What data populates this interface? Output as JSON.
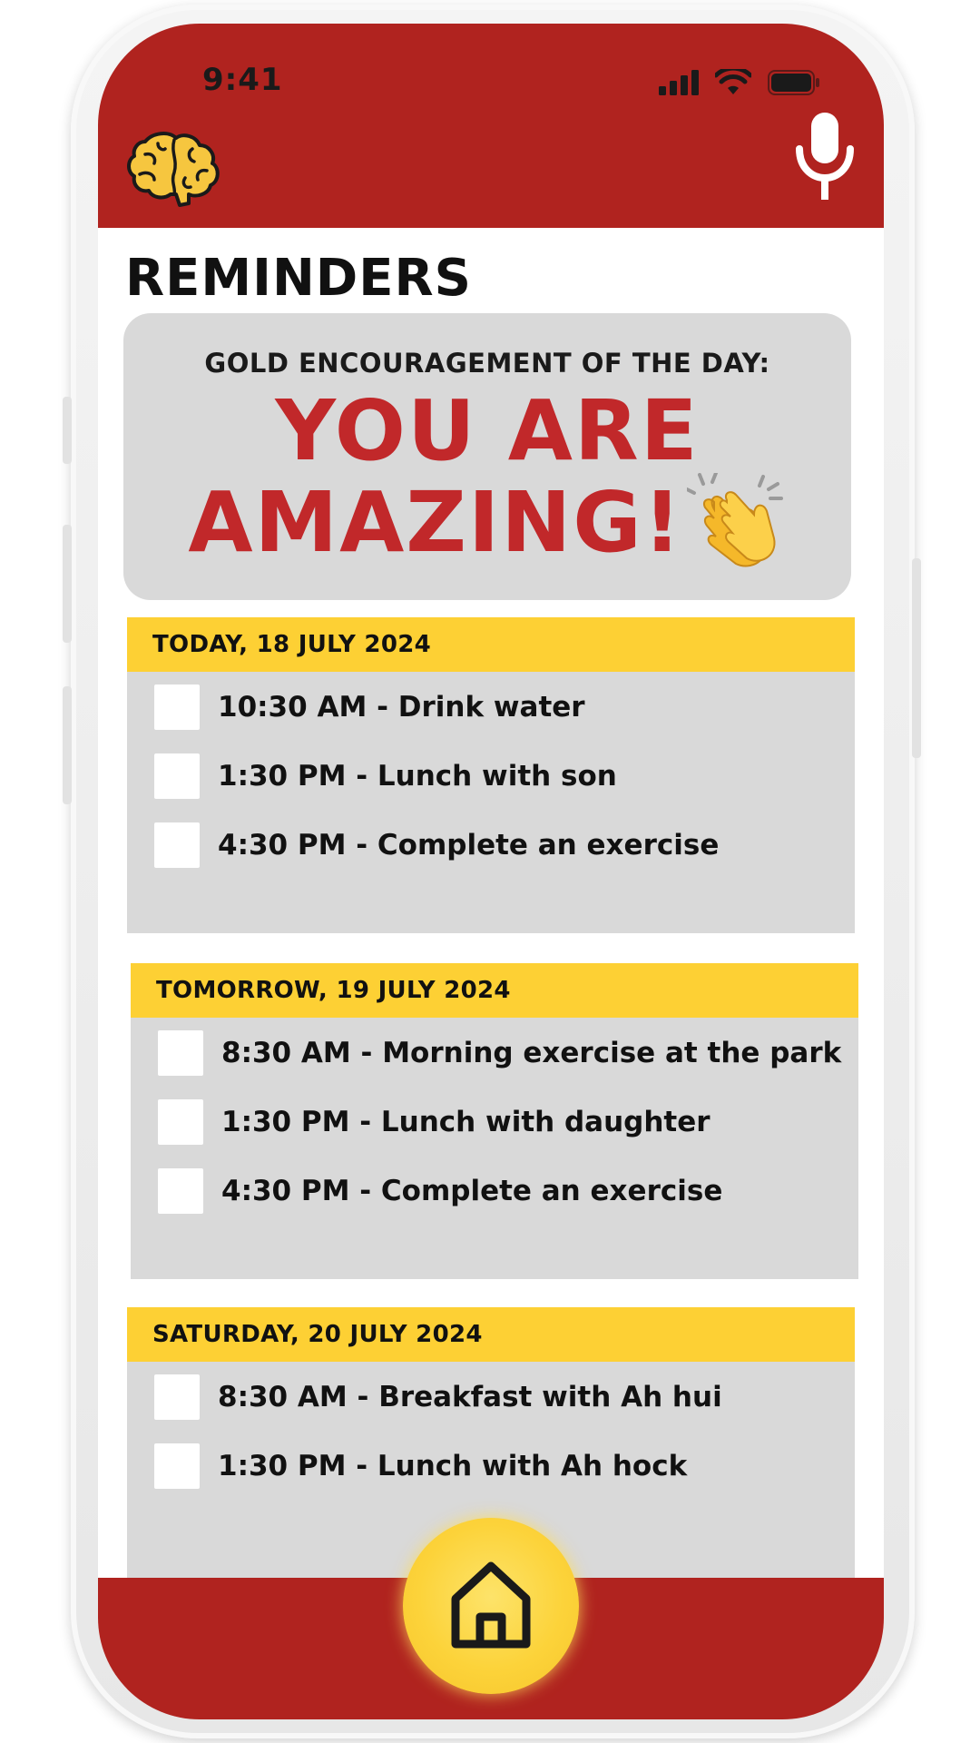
{
  "status_bar": {
    "time": "9:41"
  },
  "header": {
    "logo_icon": "brain-icon",
    "mic_icon": "microphone-icon"
  },
  "page": {
    "title": "REMINDERS"
  },
  "encouragement": {
    "label": "GOLD ENCOURAGEMENT OF THE DAY:",
    "line1": "YOU ARE",
    "line2": "AMAZING!",
    "icon": "clapping-hands-icon"
  },
  "days": [
    {
      "header": "TODAY, 18 JULY 2024",
      "tasks": [
        {
          "text": "10:30 AM - Drink water",
          "checked": false
        },
        {
          "text": "1:30 PM - Lunch with son",
          "checked": false
        },
        {
          "text": "4:30 PM - Complete an exercise",
          "checked": false
        }
      ]
    },
    {
      "header": "TOMORROW, 19 JULY 2024",
      "tasks": [
        {
          "text": "8:30 AM - Morning exercise at the park",
          "checked": false
        },
        {
          "text": "1:30 PM - Lunch with daughter",
          "checked": false
        },
        {
          "text": "4:30 PM - Complete an exercise",
          "checked": false
        }
      ]
    },
    {
      "header": "SATURDAY, 20 JULY 2024",
      "tasks": [
        {
          "text": "8:30 AM - Breakfast with Ah hui",
          "checked": false
        },
        {
          "text": "1:30 PM - Lunch with Ah hock",
          "checked": false
        }
      ]
    }
  ],
  "nav": {
    "home_icon": "home-icon"
  },
  "colors": {
    "header_red": "#b0231f",
    "accent_yellow": "#fdd034",
    "card_gray": "#d9d9d9",
    "message_red": "#c1282a"
  }
}
